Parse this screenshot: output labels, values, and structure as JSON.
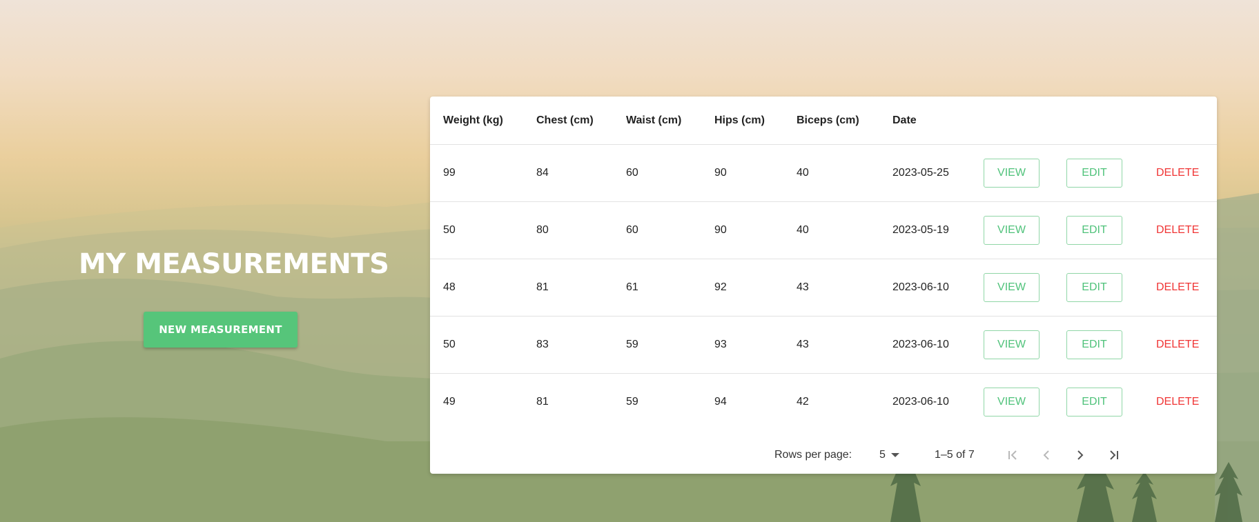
{
  "hero": {
    "title": "MY MEASUREMENTS",
    "new_button": "NEW MEASUREMENT"
  },
  "table": {
    "headers": [
      "Weight (kg)",
      "Chest (cm)",
      "Waist (cm)",
      "Hips (cm)",
      "Biceps (cm)",
      "Date"
    ],
    "rows": [
      {
        "weight": "99",
        "chest": "84",
        "waist": "60",
        "hips": "90",
        "biceps": "40",
        "date": "2023-05-25"
      },
      {
        "weight": "50",
        "chest": "80",
        "waist": "60",
        "hips": "90",
        "biceps": "40",
        "date": "2023-05-19"
      },
      {
        "weight": "48",
        "chest": "81",
        "waist": "61",
        "hips": "92",
        "biceps": "43",
        "date": "2023-06-10"
      },
      {
        "weight": "50",
        "chest": "83",
        "waist": "59",
        "hips": "93",
        "biceps": "43",
        "date": "2023-06-10"
      },
      {
        "weight": "49",
        "chest": "81",
        "waist": "59",
        "hips": "94",
        "biceps": "42",
        "date": "2023-06-10"
      }
    ],
    "actions": {
      "view": "VIEW",
      "edit": "EDIT",
      "delete": "DELETE"
    }
  },
  "pagination": {
    "rows_per_page_label": "Rows per page:",
    "rows_per_page_value": "5",
    "range": "1–5 of 7",
    "icons": [
      "first-page-icon",
      "previous-page-icon",
      "next-page-icon",
      "last-page-icon"
    ]
  },
  "colors": {
    "accent_green": "#56c57a",
    "delete_red": "#f03434",
    "outline_green": "#8fd6a6"
  }
}
